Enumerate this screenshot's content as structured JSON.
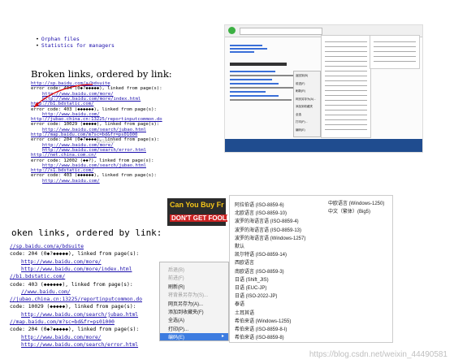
{
  "q1": {
    "nav": [
      "Orphan files",
      "Statistics for managers"
    ],
    "heading": "Broken links, ordered by link:",
    "lines": [
      {
        "t": "http://sp.baidu.com/a/bdsuite",
        "link": true
      },
      {
        "t": "error code: 404 (0◆?◆◆◆◆◆), linked from page(s):",
        "link": false
      },
      {
        "t": "http://www.baidu.com/more/",
        "link": true,
        "indent": true
      },
      {
        "t": "http://www.baidu.com/more/index.html",
        "link": true,
        "indent": true
      },
      {
        "t": "http://b1.bdstatic.com/",
        "link": true
      },
      {
        "t": "error code: 403 (◆◆◆◆◆◆), linked from page(s):",
        "link": false
      },
      {
        "t": "http://www.baidu.com/",
        "link": true,
        "indent": true
      },
      {
        "t": "http://jubao.china.cn:13225/reportinputcommon.do",
        "link": true
      },
      {
        "t": "error code: 10029 (◆◆◆◆◆), linked from page(s):",
        "link": false
      },
      {
        "t": "http://www.baidu.com/search/jubao.html",
        "link": true,
        "indent": true
      },
      {
        "t": "http://map.baidu.com/m?sc=bd&fr=ps01000",
        "link": true
      },
      {
        "t": "error code: 204 (0◆?◆◆◆◆), linked from page(s):",
        "link": false
      },
      {
        "t": "http://www.baidu.com/more/",
        "link": true,
        "indent": true
      },
      {
        "t": "http://www.baidu.com/search/error.html",
        "link": true,
        "indent": true
      },
      {
        "t": "http://net.china.com.cn/",
        "link": true
      },
      {
        "t": "error code: 12002 (◆◆?), linked from page(s):",
        "link": false
      },
      {
        "t": "http://www.baidu.com/search/jubao.html",
        "link": true,
        "indent": true
      },
      {
        "t": "http://s1.bdstatic.com/",
        "link": true
      },
      {
        "t": "error code: 403 (◆◆◆◆◆◆), linked from page(s):",
        "link": false
      },
      {
        "t": "http://www.baidu.com/",
        "link": true,
        "indent": true
      }
    ]
  },
  "q3": {
    "heading": "oken links, ordered by link:",
    "banner_top": "Can You Buy Fr",
    "banner_bottom": "DON'T GET FOOLED",
    "lines": [
      {
        "t": "//sp.baidu.com/a/bdsuite",
        "link": true
      },
      {
        "t": "code: 204 (0◆?◆◆◆◆◆), linked from page(s):",
        "link": false
      },
      {
        "t": "http://www.baidu.com/more/",
        "link": true,
        "indent": true
      },
      {
        "t": "http://www.baidu.com/more/index.html",
        "link": true,
        "indent": true
      },
      {
        "t": "//b1.bdstatic.com/",
        "link": true
      },
      {
        "t": "code: 403 (◆◆◆◆◆◆), linked from page(s):",
        "link": false
      },
      {
        "t": "//www.baidu.com/",
        "link": true,
        "indent": true
      },
      {
        "t": "//jubao.china.cn:13225/reportinputcommon.do",
        "link": true
      },
      {
        "t": "code: 10029 (◆◆◆◆◆), linked from page(s):",
        "link": false
      },
      {
        "t": "http://www.baidu.com/search/jubao.html",
        "link": true,
        "indent": true
      },
      {
        "t": "//map.baidu.com/m?sc=bd&fr=ps01000",
        "link": true
      },
      {
        "t": "code: 204 (0◆?◆◆◆◆◆), linked from page(s):",
        "link": false
      },
      {
        "t": "http://www.baidu.com/more/",
        "link": true,
        "indent": true
      },
      {
        "t": "http://www.baidu.com/search/error.html",
        "link": true,
        "indent": true
      }
    ]
  },
  "context_menu": {
    "items": [
      {
        "t": "后退(B)",
        "dis": true
      },
      {
        "t": "前进(F)",
        "dis": true
      },
      {
        "t": "刷新(R)",
        "dis": false
      },
      {
        "t": "将背景另存为(S)...",
        "dis": true
      },
      {
        "t": "网页另存为(A)...",
        "dis": false
      },
      {
        "t": "添加到收藏夹(F)",
        "dis": false
      },
      {
        "t": "全选(A)",
        "dis": false
      },
      {
        "t": "打印(P)...",
        "dis": false
      },
      {
        "t": "编码(E)",
        "sel": true
      }
    ]
  },
  "encoding_menu": {
    "col1": [
      "阿拉伯语 (ISO-8859-6)",
      "北欧语言 (ISO-8859-10)",
      "波罗的海语言语 (ISO-8859-4)",
      "波罗的海语言语 (ISO-8859-13)",
      "波罗的海语言语 (Windows-1257)",
      "默认",
      "凯尔特语 (ISO-8859-14)",
      "西欧语言",
      "南欧语言 (ISO-8859-3)",
      "日语 (Shift_JIS)",
      "日语 (EUC-JP)",
      "日语 (ISO-2022-JP)",
      "泰语",
      "土耳其语",
      "希伯来语 (Windows-1255)",
      "希伯来语 (ISO-8859-8-I)",
      "希伯来语 (ISO-8859-8)"
    ],
    "col2": [
      "中欧语言 (Windows-1250)",
      "中文（繁体）(Big5)"
    ]
  },
  "q2_menu": [
    "返回到(B)",
    "前进(F)",
    "刷新(R)",
    "网页另存为(A)...",
    "添加到收藏夹",
    "全选",
    "打印(P)...",
    "编码(E)"
  ],
  "watermark": "https://blog.csdn.net/weixin_44490581"
}
